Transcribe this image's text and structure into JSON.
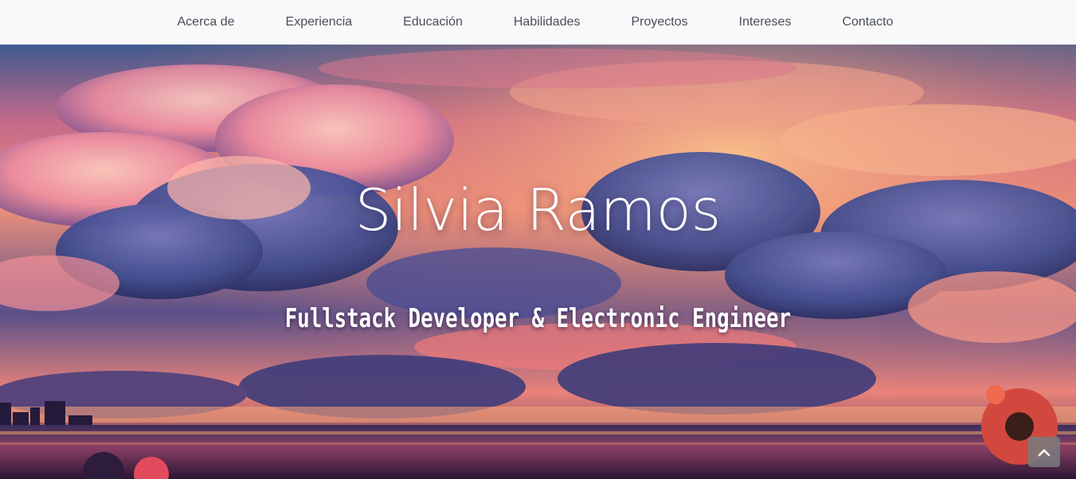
{
  "nav": {
    "items": [
      {
        "label": "Acerca de"
      },
      {
        "label": "Experiencia"
      },
      {
        "label": "Educación"
      },
      {
        "label": "Habilidades"
      },
      {
        "label": "Proyectos"
      },
      {
        "label": "Intereses"
      },
      {
        "label": "Contacto"
      }
    ]
  },
  "hero": {
    "title": "Silvia Ramos",
    "subtitle": "Fullstack Developer & Electronic Engineer",
    "background": "sunset-clouds-field-illustration"
  },
  "scroll_top": {
    "icon": "chevron-up-icon"
  },
  "colors": {
    "navbar_bg": "#f8f9fa",
    "nav_text": "#4b4f55",
    "hero_text": "#ffffff",
    "scroll_button": "#787c80"
  }
}
